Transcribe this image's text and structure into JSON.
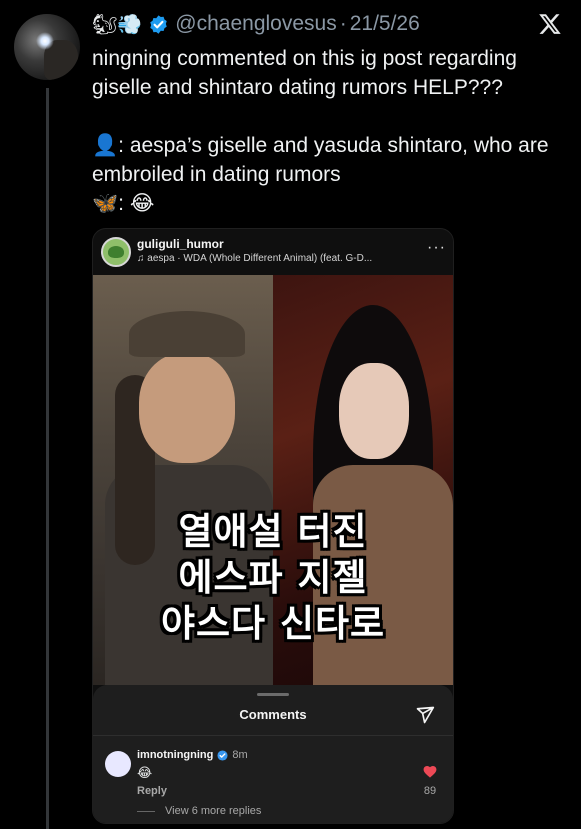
{
  "tweet": {
    "header_emojis": "🐿💨",
    "handle": "@chaenglovesus",
    "sep": "·",
    "date": "21/5/26",
    "paragraphs": [
      "ningning commented on this ig post regarding giselle and shintaro dating rumors HELP???",
      "",
      "👤: aespa’s giselle and yasuda shintaro, who are embroiled in dating rumors",
      "🦋: 😂"
    ],
    "colors": {
      "verified": "#1d9bf0",
      "handle": "#8b98a5"
    }
  },
  "ig_post": {
    "username": "guliguli_humor",
    "music": "aespa · WDA (Whole Different Animal) (feat. G-D...",
    "more": "···",
    "overlay_lines": [
      "열애설 터진",
      "에스파 지젤",
      "야스다 신타로"
    ]
  },
  "comments_sheet": {
    "title": "Comments",
    "comment": {
      "user": "imnotningning",
      "time": "8m",
      "text": "😂",
      "reply_label": "Reply",
      "likes": "89",
      "heart_color": "#ed4956"
    },
    "view_more": "View 6 more replies"
  }
}
